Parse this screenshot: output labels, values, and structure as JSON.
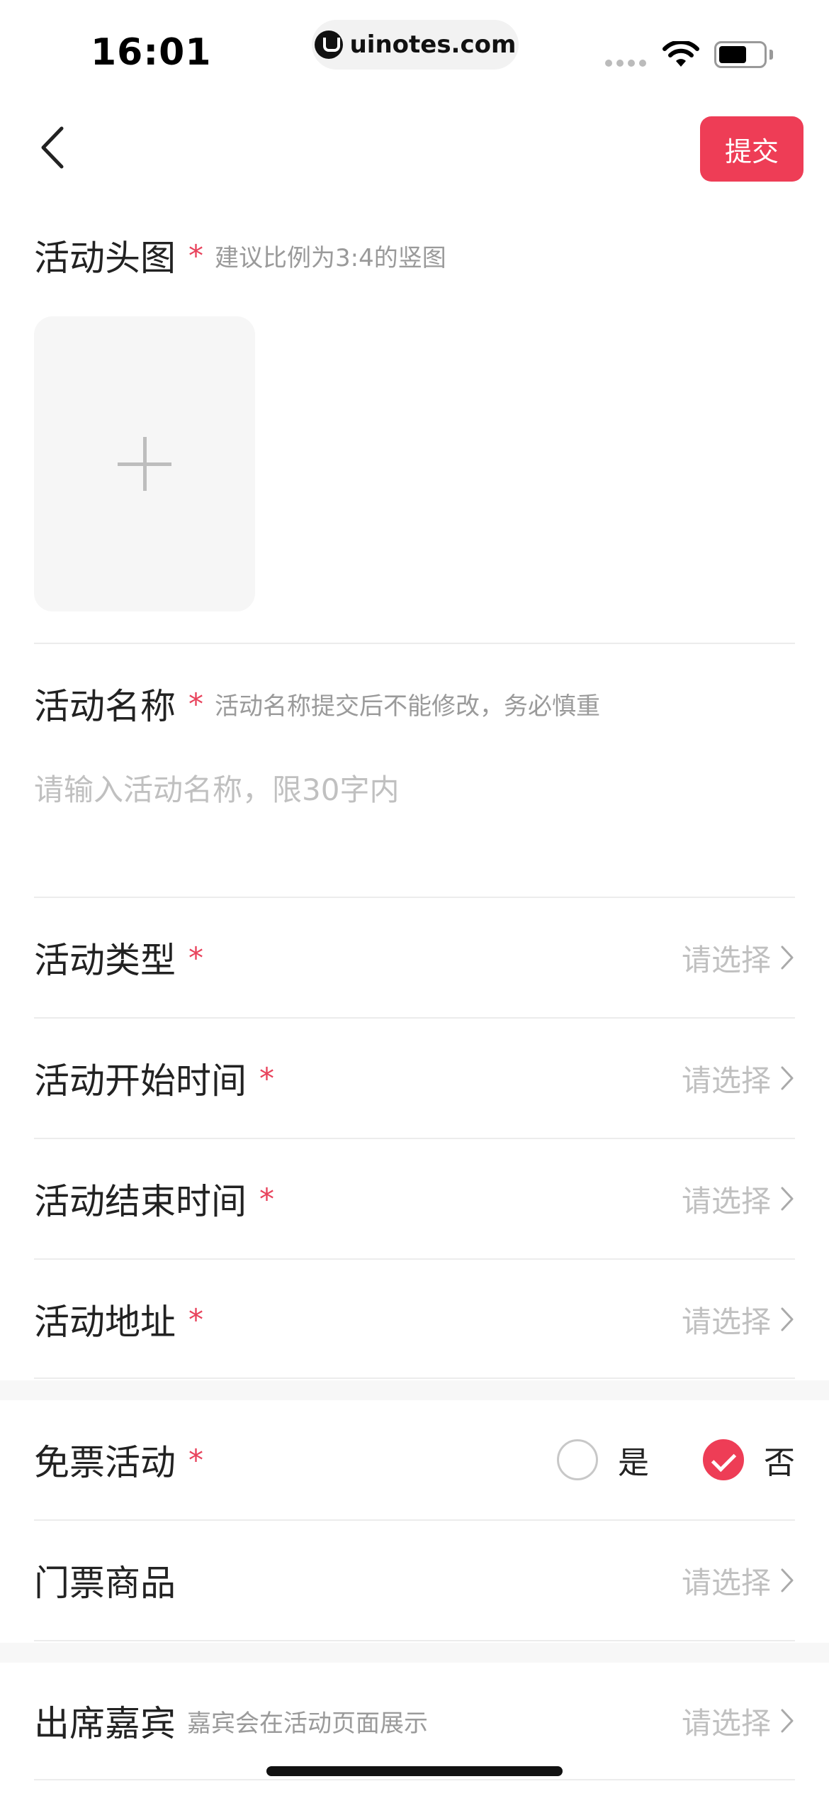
{
  "status_bar": {
    "time": "16:01",
    "url": "uinotes.com"
  },
  "nav": {
    "submit_label": "提交"
  },
  "cover": {
    "label": "活动头图",
    "required": "*",
    "hint": "建议比例为3:4的竖图"
  },
  "name": {
    "label": "活动名称",
    "required": "*",
    "hint": "活动名称提交后不能修改，务必慎重",
    "placeholder": "请输入活动名称，限30字内"
  },
  "rows": [
    {
      "label": "活动类型",
      "required": "*",
      "value": "请选择"
    },
    {
      "label": "活动开始时间",
      "required": "*",
      "value": "请选择"
    },
    {
      "label": "活动结束时间",
      "required": "*",
      "value": "请选择"
    },
    {
      "label": "活动地址",
      "required": "*",
      "value": "请选择"
    }
  ],
  "free_ticket": {
    "label": "免票活动",
    "required": "*",
    "options": [
      {
        "label": "是",
        "checked": false
      },
      {
        "label": "否",
        "checked": true
      }
    ]
  },
  "ticket_goods": {
    "label": "门票商品",
    "value": "请选择"
  },
  "guests": {
    "label": "出席嘉宾",
    "hint": "嘉宾会在活动页面展示",
    "value": "请选择"
  },
  "colors": {
    "accent": "#ee3d56",
    "placeholder": "#c0c0c0",
    "hint": "#9a9a9a"
  }
}
